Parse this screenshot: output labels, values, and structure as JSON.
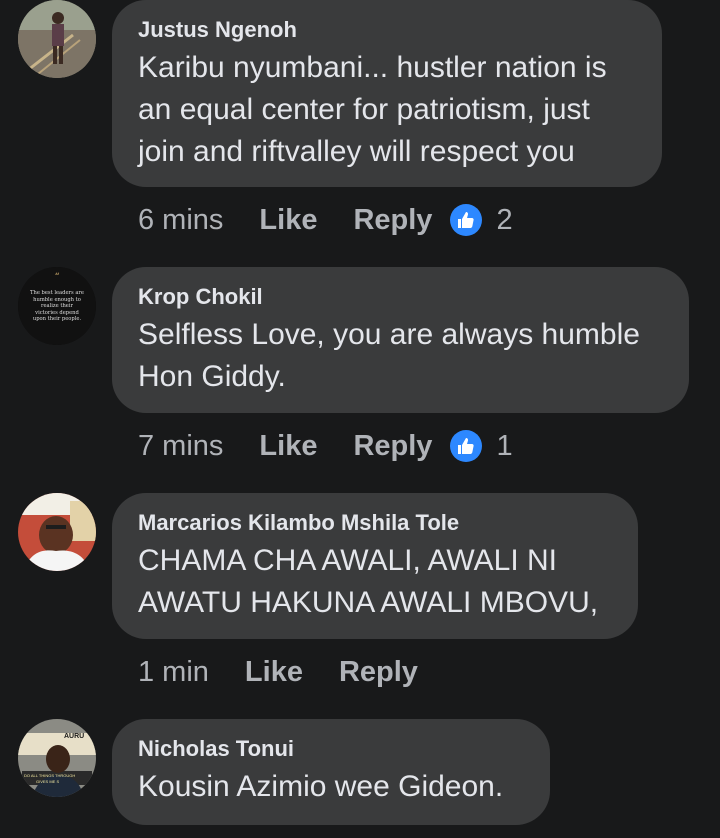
{
  "colors": {
    "background": "#18191a",
    "bubble": "#3a3b3c",
    "text": "#e4e6eb",
    "muted": "#b0b3b8",
    "like_badge": "#2d88ff"
  },
  "comments": [
    {
      "author": "Justus Ngenoh",
      "text": "Karibu nyumbani... hustler nation is an equal center for patriotism, just join and riftvalley will respect you",
      "time": "6 mins",
      "like_label": "Like",
      "reply_label": "Reply",
      "reaction_icon": "thumbs-up-icon",
      "reaction_count": "2"
    },
    {
      "author": "Krop Chokil",
      "text": "Selfless Love, you are always humble Hon Giddy.",
      "time": "7 mins",
      "like_label": "Like",
      "reply_label": "Reply",
      "reaction_icon": "thumbs-up-icon",
      "reaction_count": "1",
      "avatar_quote": "The best leaders are humble enough to realize their victories depend upon their people."
    },
    {
      "author": "Marcarios Kilambo Mshila Tole",
      "text": "CHAMA CHA AWALI, AWALI NI AWATU HAKUNA AWALI MBOVU,",
      "time": "1 min",
      "like_label": "Like",
      "reply_label": "Reply"
    },
    {
      "author": "Nicholas Tonui",
      "text": "Kousin Azimio wee Gideon.",
      "avatar_signs": [
        "AURU",
        "DO ALL THINGS THROUGH",
        "GIVES ME S"
      ]
    }
  ]
}
